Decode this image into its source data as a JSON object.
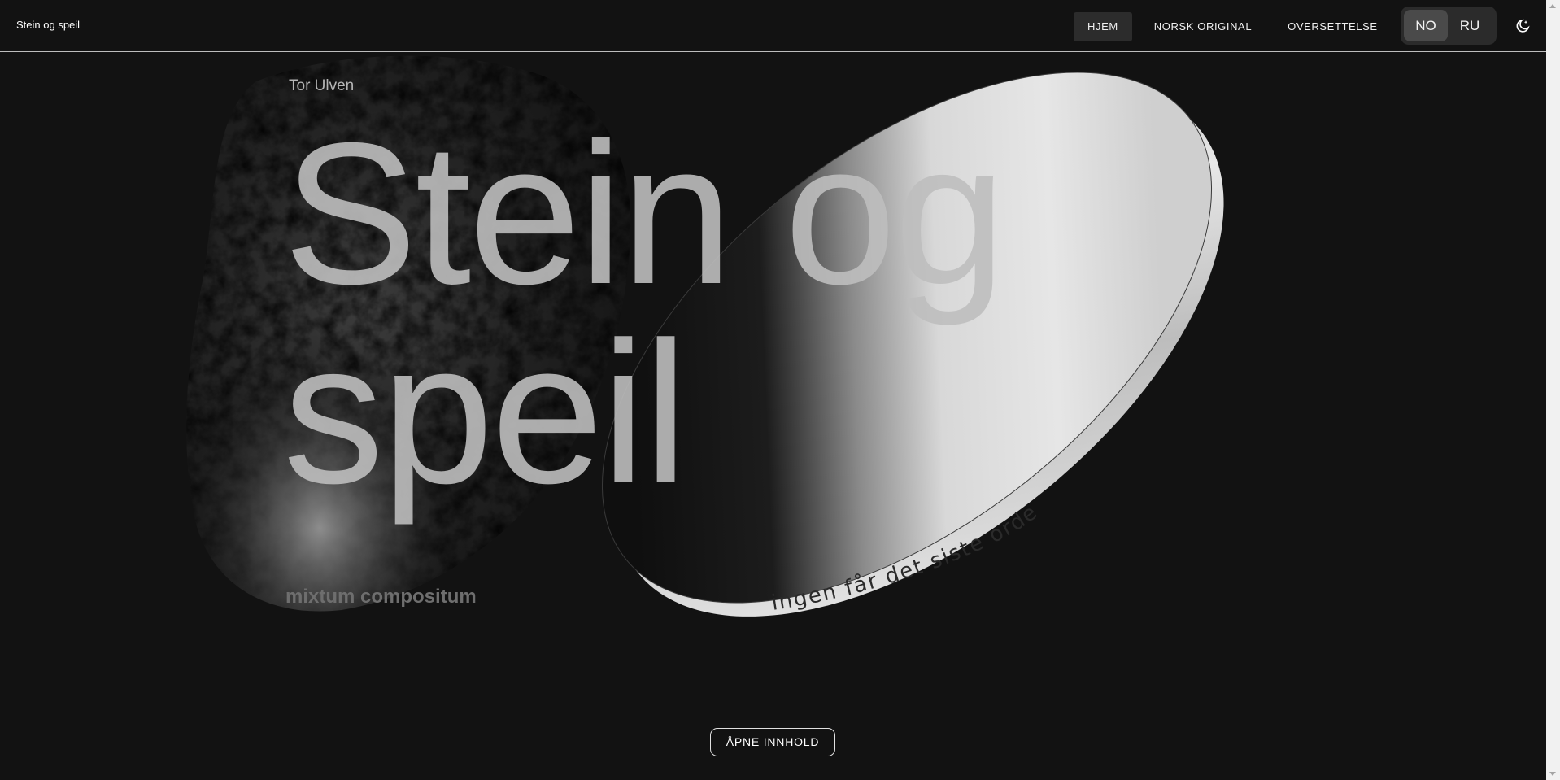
{
  "header": {
    "site_title": "Stein og speil",
    "nav": [
      {
        "label": "HJEM",
        "active": true
      },
      {
        "label": "NORSK ORIGINAL",
        "active": false
      },
      {
        "label": "OVERSETTELSE",
        "active": false
      }
    ],
    "languages": [
      {
        "label": "NO",
        "active": true
      },
      {
        "label": "RU",
        "active": false
      }
    ],
    "theme_icon": "moon-star-icon"
  },
  "hero": {
    "author": "Tor Ulven",
    "title_line1": "Stein og",
    "title_line2": "speil",
    "subtitle": "mixtum compositum",
    "mirror_inscription": "ingen får det siste ordet",
    "cta_label": "ÅPNE INNHOLD"
  },
  "colors": {
    "background": "#121212",
    "title": "#bebebe",
    "subtitle": "#6e6e6e"
  }
}
